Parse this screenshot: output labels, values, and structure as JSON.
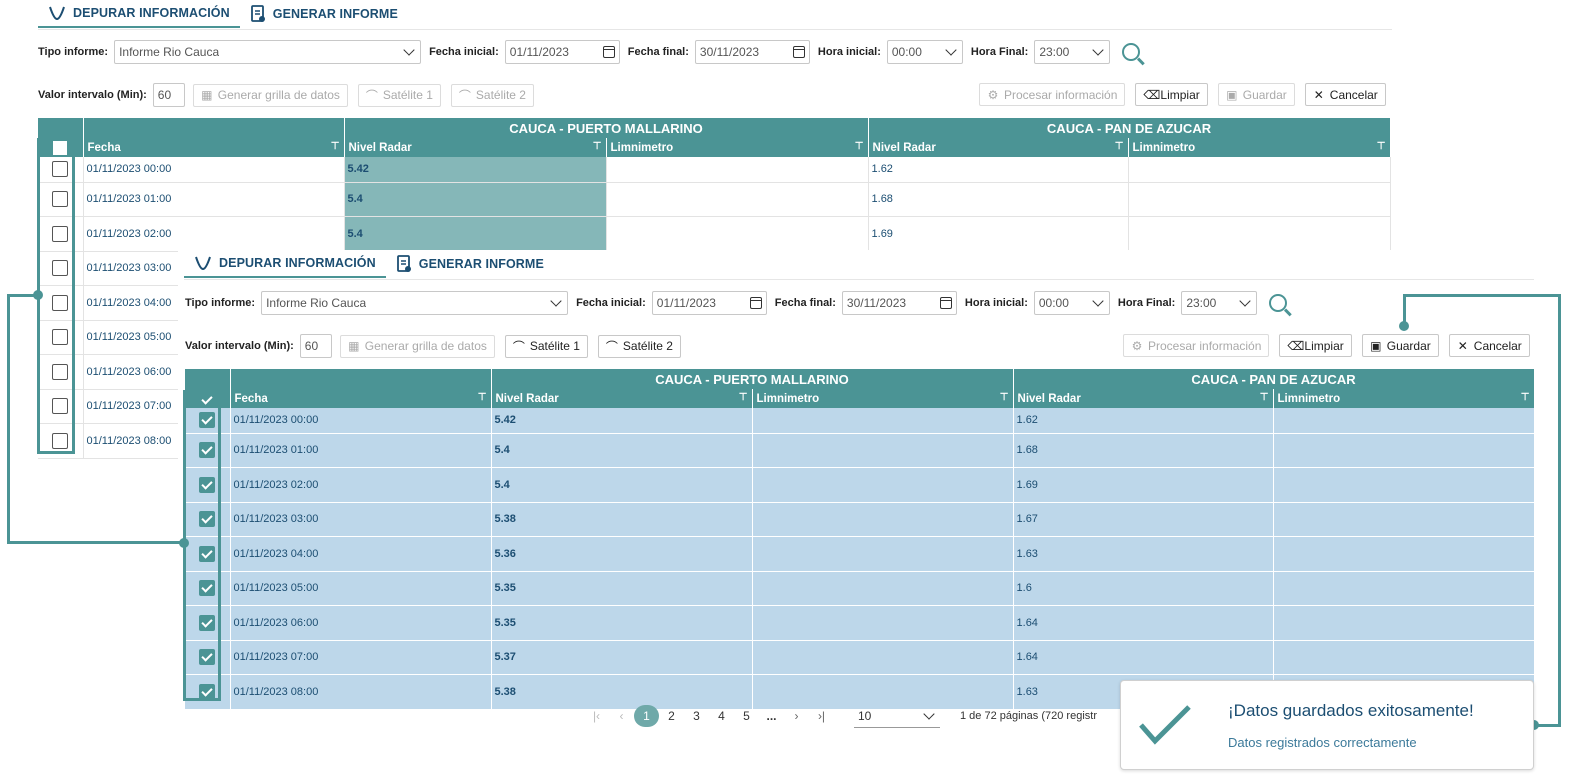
{
  "tabs": {
    "depurar": "DEPURAR INFORMACIÓN",
    "generar": "GENERAR INFORME"
  },
  "filters": {
    "tipo_label": "Tipo informe:",
    "tipo_value": "Informe Rio Cauca",
    "fi_label": "Fecha inicial:",
    "fi_value": "01/11/2023",
    "ff_label": "Fecha final:",
    "ff_value": "30/11/2023",
    "hi_label": "Hora inicial:",
    "hi_value": "00:00",
    "hf_label": "Hora Final:",
    "hf_value": "23:00"
  },
  "toolbar": {
    "intervalo_label": "Valor intervalo (Min):",
    "intervalo_value": "60",
    "generar": "Generar grilla de datos",
    "sat1": "Satélite 1",
    "sat2": "Satélite 2",
    "procesar": "Procesar información",
    "limpiar": "Limpiar",
    "guardar": "Guardar",
    "cancelar": "Cancelar"
  },
  "grid": {
    "group1": "CAUCA - PUERTO MALLARINO",
    "group2": "CAUCA - PAN DE AZUCAR",
    "col_fecha": "Fecha",
    "col_nivel": "Nivel Radar",
    "col_limni": "Limnimetro",
    "rows": [
      {
        "fecha": "01/11/2023 00:00",
        "nivel1": "5.42",
        "nivel2": "1.62"
      },
      {
        "fecha": "01/11/2023 01:00",
        "nivel1": "5.4",
        "nivel2": "1.68"
      },
      {
        "fecha": "01/11/2023 02:00",
        "nivel1": "5.4",
        "nivel2": "1.69"
      },
      {
        "fecha": "01/11/2023 03:00",
        "nivel1": "5.38",
        "nivel2": "1.67"
      },
      {
        "fecha": "01/11/2023 04:00",
        "nivel1": "5.36",
        "nivel2": "1.63"
      },
      {
        "fecha": "01/11/2023 05:00",
        "nivel1": "5.35",
        "nivel2": "1.6"
      },
      {
        "fecha": "01/11/2023 06:00",
        "nivel1": "5.35",
        "nivel2": "1.64"
      },
      {
        "fecha": "01/11/2023 07:00",
        "nivel1": "5.37",
        "nivel2": "1.64"
      },
      {
        "fecha": "01/11/2023 08:00",
        "nivel1": "5.38",
        "nivel2": "1.63"
      }
    ]
  },
  "pager": {
    "pages": [
      "1",
      "2",
      "3",
      "4",
      "5",
      "..."
    ],
    "page_size": "10",
    "info": "1 de 72 páginas (720 registr"
  },
  "toast": {
    "title": "¡Datos guardados exitosamente!",
    "message": "Datos registrados correctamente"
  },
  "colors": {
    "accent": "#4b9495",
    "selected_row": "#bdd7ea",
    "text_blue": "#1c4e72"
  }
}
